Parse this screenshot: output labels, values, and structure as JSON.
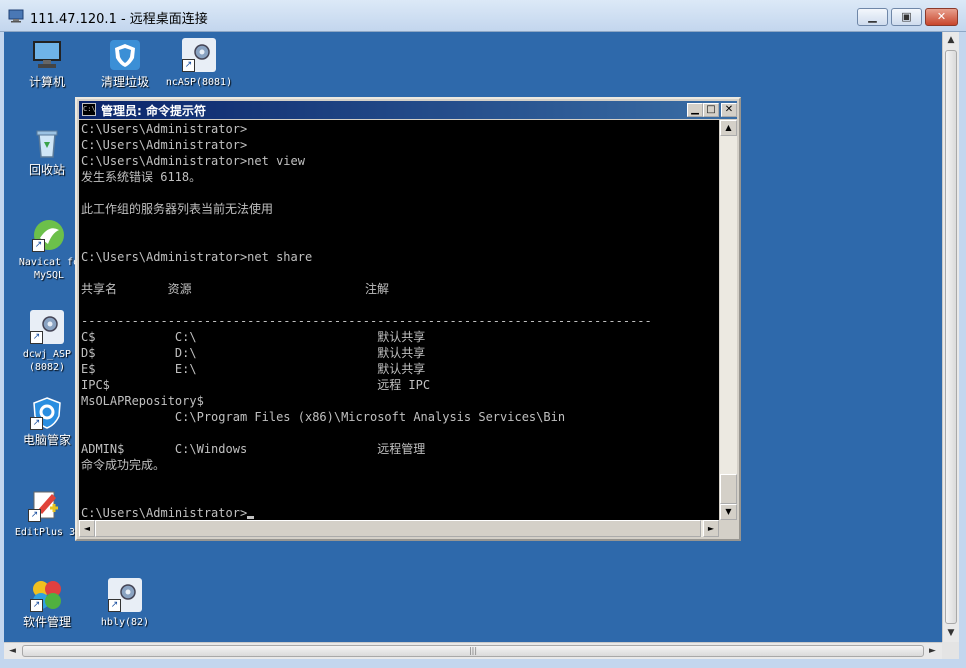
{
  "rdp_window": {
    "title": "111.47.120.1 - 远程桌面连接",
    "min_glyph": "▁",
    "max_glyph": "▣",
    "close_glyph": "✕"
  },
  "desktop_icons": [
    {
      "label": "计算机"
    },
    {
      "label": "清理垃圾"
    },
    {
      "label": "ncASP(8081)"
    },
    {
      "label": "回收站"
    },
    {
      "label": "Navicat fo MySQL"
    },
    {
      "label": "dcwj_ASP (8082)"
    },
    {
      "label": "电脑管家"
    },
    {
      "label": "EditPlus 3"
    },
    {
      "label": "软件管理"
    },
    {
      "label": "hbly(82)"
    }
  ],
  "cmd_window": {
    "title": "管理员: 命令提示符",
    "icon_text": "C:\\",
    "lines": [
      "C:\\Users\\Administrator>",
      "C:\\Users\\Administrator>",
      "C:\\Users\\Administrator>net view",
      "发生系统错误 6118。",
      "",
      "此工作组的服务器列表当前无法使用",
      "",
      "",
      "C:\\Users\\Administrator>net share",
      "",
      "共享名       资源                        注解",
      "",
      "-------------------------------------------------------------------------------",
      "C$           C:\\                         默认共享",
      "D$           D:\\                         默认共享",
      "E$           E:\\                         默认共享",
      "IPC$                                     远程 IPC",
      "MsOLAPRepository$",
      "             C:\\Program Files (x86)\\Microsoft Analysis Services\\Bin",
      "",
      "ADMIN$       C:\\Windows                  远程管理",
      "命令成功完成。",
      "",
      "",
      "C:\\Users\\Administrator>"
    ]
  },
  "scroll_glyphs": {
    "up": "▲",
    "down": "▼",
    "left": "◄",
    "right": "►",
    "grip": "|||"
  }
}
